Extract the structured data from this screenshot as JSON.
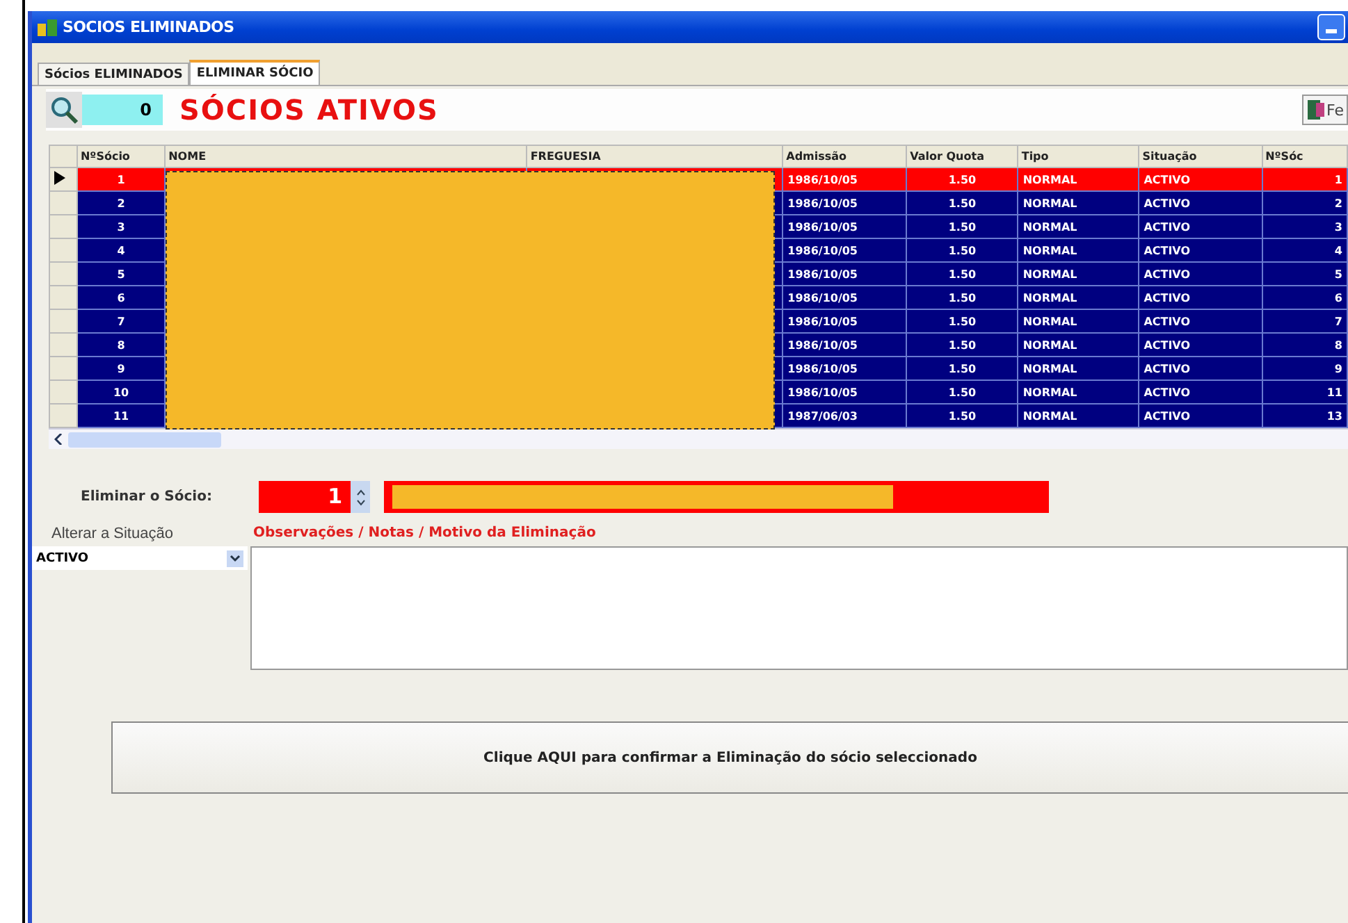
{
  "window": {
    "title": "SOCIOS ELIMINADOS"
  },
  "tabs": [
    {
      "label": "Sócios ELIMINADOS",
      "selected": false
    },
    {
      "label": "ELIMINAR SÓCIO",
      "selected": true
    }
  ],
  "toolbar": {
    "count": "0",
    "heading": "SÓCIOS ATIVOS",
    "exit_button": "Fe"
  },
  "table": {
    "columns": [
      "NºSócio",
      "NOME",
      "FREGUESIA",
      "Admissão",
      "Valor Quota",
      "Tipo",
      "Situação",
      "NºSóc"
    ],
    "rows": [
      {
        "selected": true,
        "cells": [
          "1",
          "",
          "",
          "1986/10/05",
          "1.50",
          "NORMAL",
          "ACTIVO",
          "1"
        ]
      },
      {
        "selected": false,
        "cells": [
          "2",
          "",
          "",
          "1986/10/05",
          "1.50",
          "NORMAL",
          "ACTIVO",
          "2"
        ]
      },
      {
        "selected": false,
        "cells": [
          "3",
          "",
          "",
          "1986/10/05",
          "1.50",
          "NORMAL",
          "ACTIVO",
          "3"
        ]
      },
      {
        "selected": false,
        "cells": [
          "4",
          "",
          "",
          "1986/10/05",
          "1.50",
          "NORMAL",
          "ACTIVO",
          "4"
        ]
      },
      {
        "selected": false,
        "cells": [
          "5",
          "",
          "",
          "1986/10/05",
          "1.50",
          "NORMAL",
          "ACTIVO",
          "5"
        ]
      },
      {
        "selected": false,
        "cells": [
          "6",
          "",
          "",
          "1986/10/05",
          "1.50",
          "NORMAL",
          "ACTIVO",
          "6"
        ]
      },
      {
        "selected": false,
        "cells": [
          "7",
          "",
          "",
          "1986/10/05",
          "1.50",
          "NORMAL",
          "ACTIVO",
          "7"
        ]
      },
      {
        "selected": false,
        "cells": [
          "8",
          "",
          "",
          "1986/10/05",
          "1.50",
          "NORMAL",
          "ACTIVO",
          "8"
        ]
      },
      {
        "selected": false,
        "cells": [
          "9",
          "",
          "",
          "1986/10/05",
          "1.50",
          "NORMAL",
          "ACTIVO",
          "9"
        ]
      },
      {
        "selected": false,
        "cells": [
          "10",
          "",
          "",
          "1986/10/05",
          "1.50",
          "NORMAL",
          "ACTIVO",
          "11"
        ]
      },
      {
        "selected": false,
        "cells": [
          "11",
          "",
          "",
          "1987/06/03",
          "1.50",
          "NORMAL",
          "ACTIVO",
          "13"
        ]
      }
    ]
  },
  "form": {
    "member_label": "Eliminar o Sócio:",
    "member_number": "1",
    "status_label": "Alterar a Situação",
    "status_value": "ACTIVO",
    "notes_label": "Observações / Notas / Motivo da Eliminação",
    "confirm_button": "Clique AQUI para confirmar a Eliminação do sócio seleccionado"
  }
}
